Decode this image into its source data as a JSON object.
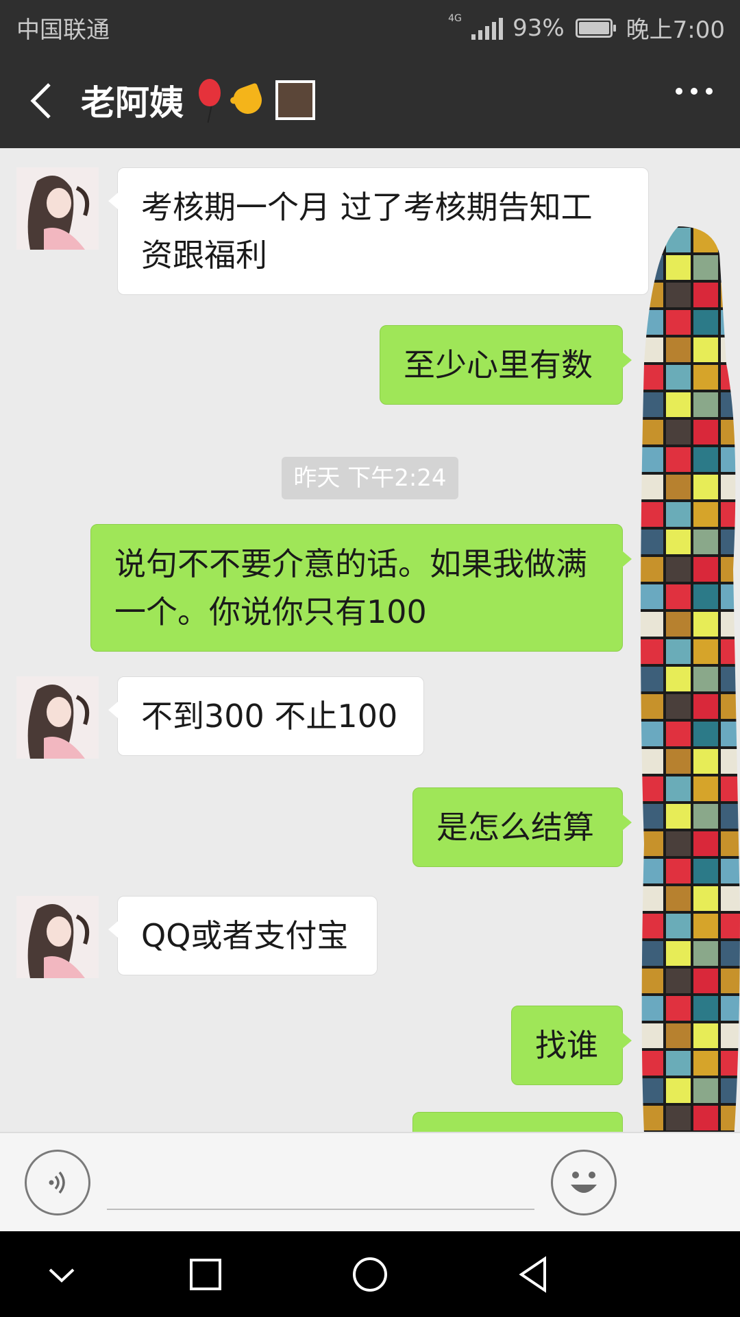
{
  "status_bar": {
    "carrier": "中国联通",
    "network": "4G",
    "battery": "93%",
    "time": "晚上7:00"
  },
  "header": {
    "contact_name": "老阿姨",
    "emoji_icons": [
      "balloon-icon",
      "backhand-index-pointing-left-icon",
      "square-box-icon"
    ]
  },
  "messages": [
    {
      "side": "in",
      "text_line1": "考核期一个月   过了考核期告知工",
      "text_line2": "资跟福利"
    },
    {
      "side": "out",
      "text": "至少心里有数"
    },
    {
      "type": "timestamp",
      "text": "昨天 下午2:24"
    },
    {
      "side": "out",
      "text_line1": "说句不不要介意的话。如果我做满",
      "text_line2": "一个。你说你只有100"
    },
    {
      "side": "in",
      "text": "不到300 不止100"
    },
    {
      "side": "out",
      "text": "是怎么结算"
    },
    {
      "side": "in",
      "text": "QQ或者支付宝"
    },
    {
      "side": "out",
      "text": "找谁"
    }
  ],
  "input_bar": {
    "placeholder": "",
    "voice_icon": "voice-icon",
    "emoji_icon": "smiley-icon"
  },
  "nav_bar": {
    "icons": [
      "chevron-down-icon",
      "square-icon",
      "circle-icon",
      "triangle-back-icon"
    ]
  },
  "colors": {
    "header_bg": "#2f2f2f",
    "chat_bg": "#ebebeb",
    "outgoing_bubble": "#9fe658",
    "incoming_bubble": "#ffffff"
  }
}
